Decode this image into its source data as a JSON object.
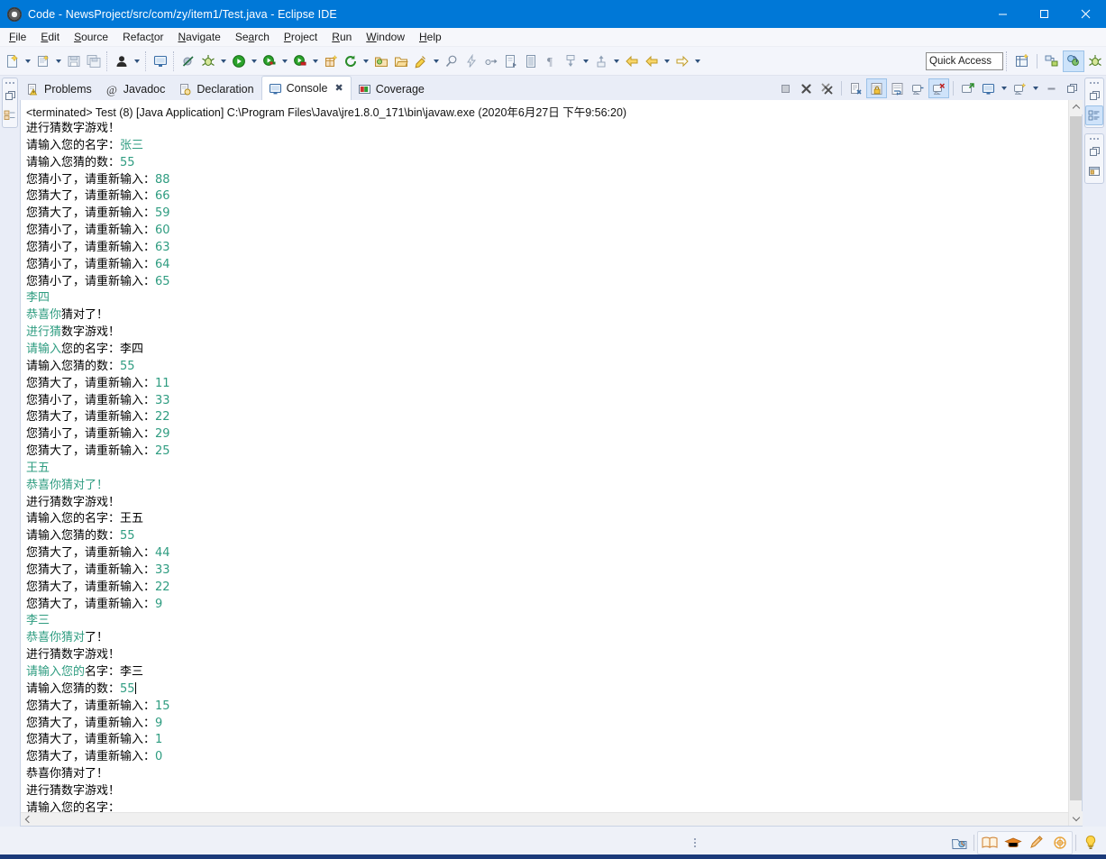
{
  "window": {
    "title": "Code - NewsProject/src/com/zy/item1/Test.java - Eclipse IDE",
    "app_icon": "eclipse-icon",
    "minimize_label": "—",
    "maximize_label": "□",
    "close_label": "✕"
  },
  "menubar": {
    "items": [
      {
        "label": "File",
        "mnemonic": "F"
      },
      {
        "label": "Edit",
        "mnemonic": "E"
      },
      {
        "label": "Source",
        "mnemonic": "S"
      },
      {
        "label": "Refactor",
        "mnemonic": "t"
      },
      {
        "label": "Navigate",
        "mnemonic": "N"
      },
      {
        "label": "Search",
        "mnemonic": "a"
      },
      {
        "label": "Project",
        "mnemonic": "P"
      },
      {
        "label": "Run",
        "mnemonic": "R"
      },
      {
        "label": "Window",
        "mnemonic": "W"
      },
      {
        "label": "Help",
        "mnemonic": "H"
      }
    ]
  },
  "toolbar": {
    "quick_access_placeholder": "Quick Access",
    "quick_access_value": "",
    "icons": [
      "new-wizard-icon",
      "new-java-class-icon",
      "save-icon",
      "save-all-icon",
      "user-icon",
      "print-screen-icon",
      "toggle-breakpoint-icon",
      "debug-icon",
      "run-icon",
      "run-coverage-icon",
      "run-last-icon",
      "new-package-icon",
      "refresh-icon",
      "open-type-icon",
      "open-task-icon",
      "search-icon",
      "annotation-icon",
      "skip-breakpoints-icon",
      "step-icon",
      "next-edit-icon",
      "outline-icon",
      "paragraph-icon",
      "previous-annotation-icon",
      "next-annotation-icon",
      "back-icon",
      "forward-icon",
      "next-icon"
    ],
    "perspective_icons": [
      "open-perspective-icon",
      "java-perspective-icon",
      "java-ee-perspective-icon",
      "debug-perspective-icon"
    ]
  },
  "view": {
    "tabs": [
      {
        "label": "Problems",
        "icon": "problems-icon",
        "active": false,
        "closable": false
      },
      {
        "label": "Javadoc",
        "icon": "javadoc-icon",
        "active": false,
        "closable": false
      },
      {
        "label": "Declaration",
        "icon": "declaration-icon",
        "active": false,
        "closable": false
      },
      {
        "label": "Console",
        "icon": "console-icon",
        "active": true,
        "closable": true
      },
      {
        "label": "Coverage",
        "icon": "coverage-icon",
        "active": false,
        "closable": false
      }
    ],
    "close_glyph": "✖",
    "toolbar_icons": [
      {
        "name": "terminate-icon",
        "active": false
      },
      {
        "name": "remove-launch-icon",
        "active": false
      },
      {
        "name": "remove-all-terminated-icon",
        "active": false
      },
      {
        "name": "clear-console-icon",
        "active": false
      },
      {
        "name": "scroll-lock-icon",
        "active": true
      },
      {
        "name": "word-wrap-icon",
        "active": false
      },
      {
        "name": "show-console-on-output-icon",
        "active": false
      },
      {
        "name": "pin-console-icon",
        "active": true
      },
      {
        "name": "open-console-icon",
        "active": false
      },
      {
        "name": "display-selected-console-icon",
        "active": false
      },
      {
        "name": "new-console-view-icon",
        "active": false
      },
      {
        "name": "minimize-icon",
        "active": false
      },
      {
        "name": "maximize-icon",
        "active": false
      }
    ]
  },
  "console": {
    "header": "<terminated> Test (8) [Java Application] C:\\Program Files\\Java\\jre1.8.0_171\\bin\\javaw.exe (2020年6月27日 下午9:56:20)",
    "lines": [
      {
        "segments": [
          {
            "t": "进行猜数字游戏！",
            "c": "k"
          }
        ]
      },
      {
        "segments": [
          {
            "t": "请输入您的名字：",
            "c": "k"
          },
          {
            "t": "张三",
            "c": "g"
          }
        ]
      },
      {
        "segments": [
          {
            "t": "请输入您猜的数：",
            "c": "k"
          },
          {
            "t": "55",
            "c": "g"
          }
        ]
      },
      {
        "segments": [
          {
            "t": "您猜小了，请重新输入：",
            "c": "k"
          },
          {
            "t": "88",
            "c": "g"
          }
        ]
      },
      {
        "segments": [
          {
            "t": "您猜大了，请重新输入：",
            "c": "k"
          },
          {
            "t": "66",
            "c": "g"
          }
        ]
      },
      {
        "segments": [
          {
            "t": "您猜大了，请重新输入：",
            "c": "k"
          },
          {
            "t": "59",
            "c": "g"
          }
        ]
      },
      {
        "segments": [
          {
            "t": "您猜小了，请重新输入：",
            "c": "k"
          },
          {
            "t": "60",
            "c": "g"
          }
        ]
      },
      {
        "segments": [
          {
            "t": "您猜小了，请重新输入：",
            "c": "k"
          },
          {
            "t": "63",
            "c": "g"
          }
        ]
      },
      {
        "segments": [
          {
            "t": "您猜小了，请重新输入：",
            "c": "k"
          },
          {
            "t": "64",
            "c": "g"
          }
        ]
      },
      {
        "segments": [
          {
            "t": "您猜小了，请重新输入：",
            "c": "k"
          },
          {
            "t": "65",
            "c": "g"
          }
        ]
      },
      {
        "segments": [
          {
            "t": "李四",
            "c": "g"
          }
        ]
      },
      {
        "segments": [
          {
            "t": "恭喜你",
            "c": "g"
          },
          {
            "t": "猜对了！",
            "c": "k"
          }
        ]
      },
      {
        "segments": [
          {
            "t": "进行猜",
            "c": "g"
          },
          {
            "t": "数字游戏！",
            "c": "k"
          }
        ]
      },
      {
        "segments": [
          {
            "t": "请输入",
            "c": "g"
          },
          {
            "t": "您的名字：李四",
            "c": "k"
          }
        ]
      },
      {
        "segments": [
          {
            "t": "请输入您猜的数：",
            "c": "k"
          },
          {
            "t": "55",
            "c": "g"
          }
        ]
      },
      {
        "segments": [
          {
            "t": "您猜大了，请重新输入：",
            "c": "k"
          },
          {
            "t": "11",
            "c": "g"
          }
        ]
      },
      {
        "segments": [
          {
            "t": "您猜小了，请重新输入：",
            "c": "k"
          },
          {
            "t": "33",
            "c": "g"
          }
        ]
      },
      {
        "segments": [
          {
            "t": "您猜大了，请重新输入：",
            "c": "k"
          },
          {
            "t": "22",
            "c": "g"
          }
        ]
      },
      {
        "segments": [
          {
            "t": "您猜小了，请重新输入：",
            "c": "k"
          },
          {
            "t": "29",
            "c": "g"
          }
        ]
      },
      {
        "segments": [
          {
            "t": "您猜大了，请重新输入：",
            "c": "k"
          },
          {
            "t": "25",
            "c": "g"
          }
        ]
      },
      {
        "segments": [
          {
            "t": "王五",
            "c": "g"
          }
        ]
      },
      {
        "segments": [
          {
            "t": "恭喜你猜对了！",
            "c": "g"
          }
        ]
      },
      {
        "segments": [
          {
            "t": "进行猜数字游戏！",
            "c": "k"
          }
        ]
      },
      {
        "segments": [
          {
            "t": "请输入您的名字：王五",
            "c": "k"
          }
        ]
      },
      {
        "segments": [
          {
            "t": "请输入您猜的数：",
            "c": "k"
          },
          {
            "t": "55",
            "c": "g"
          }
        ]
      },
      {
        "segments": [
          {
            "t": "您猜大了，请重新输入：",
            "c": "k"
          },
          {
            "t": "44",
            "c": "g"
          }
        ]
      },
      {
        "segments": [
          {
            "t": "您猜大了，请重新输入：",
            "c": "k"
          },
          {
            "t": "33",
            "c": "g"
          }
        ]
      },
      {
        "segments": [
          {
            "t": "您猜大了，请重新输入：",
            "c": "k"
          },
          {
            "t": "22",
            "c": "g"
          }
        ]
      },
      {
        "segments": [
          {
            "t": "您猜大了，请重新输入：",
            "c": "k"
          },
          {
            "t": "9",
            "c": "g"
          }
        ]
      },
      {
        "segments": [
          {
            "t": "李三",
            "c": "g"
          }
        ]
      },
      {
        "segments": [
          {
            "t": "恭喜你猜对",
            "c": "g"
          },
          {
            "t": "了！",
            "c": "k"
          }
        ]
      },
      {
        "segments": [
          {
            "t": "进行猜数字游戏！",
            "c": "k"
          }
        ]
      },
      {
        "segments": [
          {
            "t": "请输入您的",
            "c": "g"
          },
          {
            "t": "名字：李三",
            "c": "k"
          }
        ]
      },
      {
        "segments": [
          {
            "t": "请输入您猜的数：",
            "c": "k"
          },
          {
            "t": "55",
            "c": "g"
          },
          {
            "t": "",
            "c": "cursor"
          }
        ]
      },
      {
        "segments": [
          {
            "t": "您猜大了，请重新输入：",
            "c": "k"
          },
          {
            "t": "15",
            "c": "g"
          }
        ]
      },
      {
        "segments": [
          {
            "t": "您猜大了，请重新输入：",
            "c": "k"
          },
          {
            "t": "9",
            "c": "g"
          }
        ]
      },
      {
        "segments": [
          {
            "t": "您猜大了，请重新输入：",
            "c": "k"
          },
          {
            "t": "1",
            "c": "g"
          }
        ]
      },
      {
        "segments": [
          {
            "t": "您猜大了，请重新输入：",
            "c": "k"
          },
          {
            "t": "0",
            "c": "g"
          }
        ]
      },
      {
        "segments": [
          {
            "t": "恭喜你猜对了！",
            "c": "k"
          }
        ]
      },
      {
        "segments": [
          {
            "t": "进行猜数字游戏！",
            "c": "k"
          }
        ]
      },
      {
        "segments": [
          {
            "t": "请输入您的名字：",
            "c": "k"
          }
        ]
      }
    ]
  },
  "rails": {
    "left": [
      {
        "icons": [
          "restore-icon",
          "package-explorer-icon"
        ]
      }
    ],
    "right": [
      {
        "icons": [
          "restore-icon",
          "outline-icon"
        ]
      },
      {
        "icons": [
          "restore-icon",
          "task-list-icon"
        ]
      }
    ]
  },
  "statusbar": {
    "icons": [
      "coverage-view-icon",
      "book-icon",
      "graduation-cap-icon",
      "pencil-icon",
      "target-icon",
      "lightbulb-icon"
    ]
  },
  "colors": {
    "title_bar": "#0078d7",
    "console_input_green": "#2e9c80",
    "console_text": "#000000",
    "accent_selected": "#cfe3fa"
  }
}
